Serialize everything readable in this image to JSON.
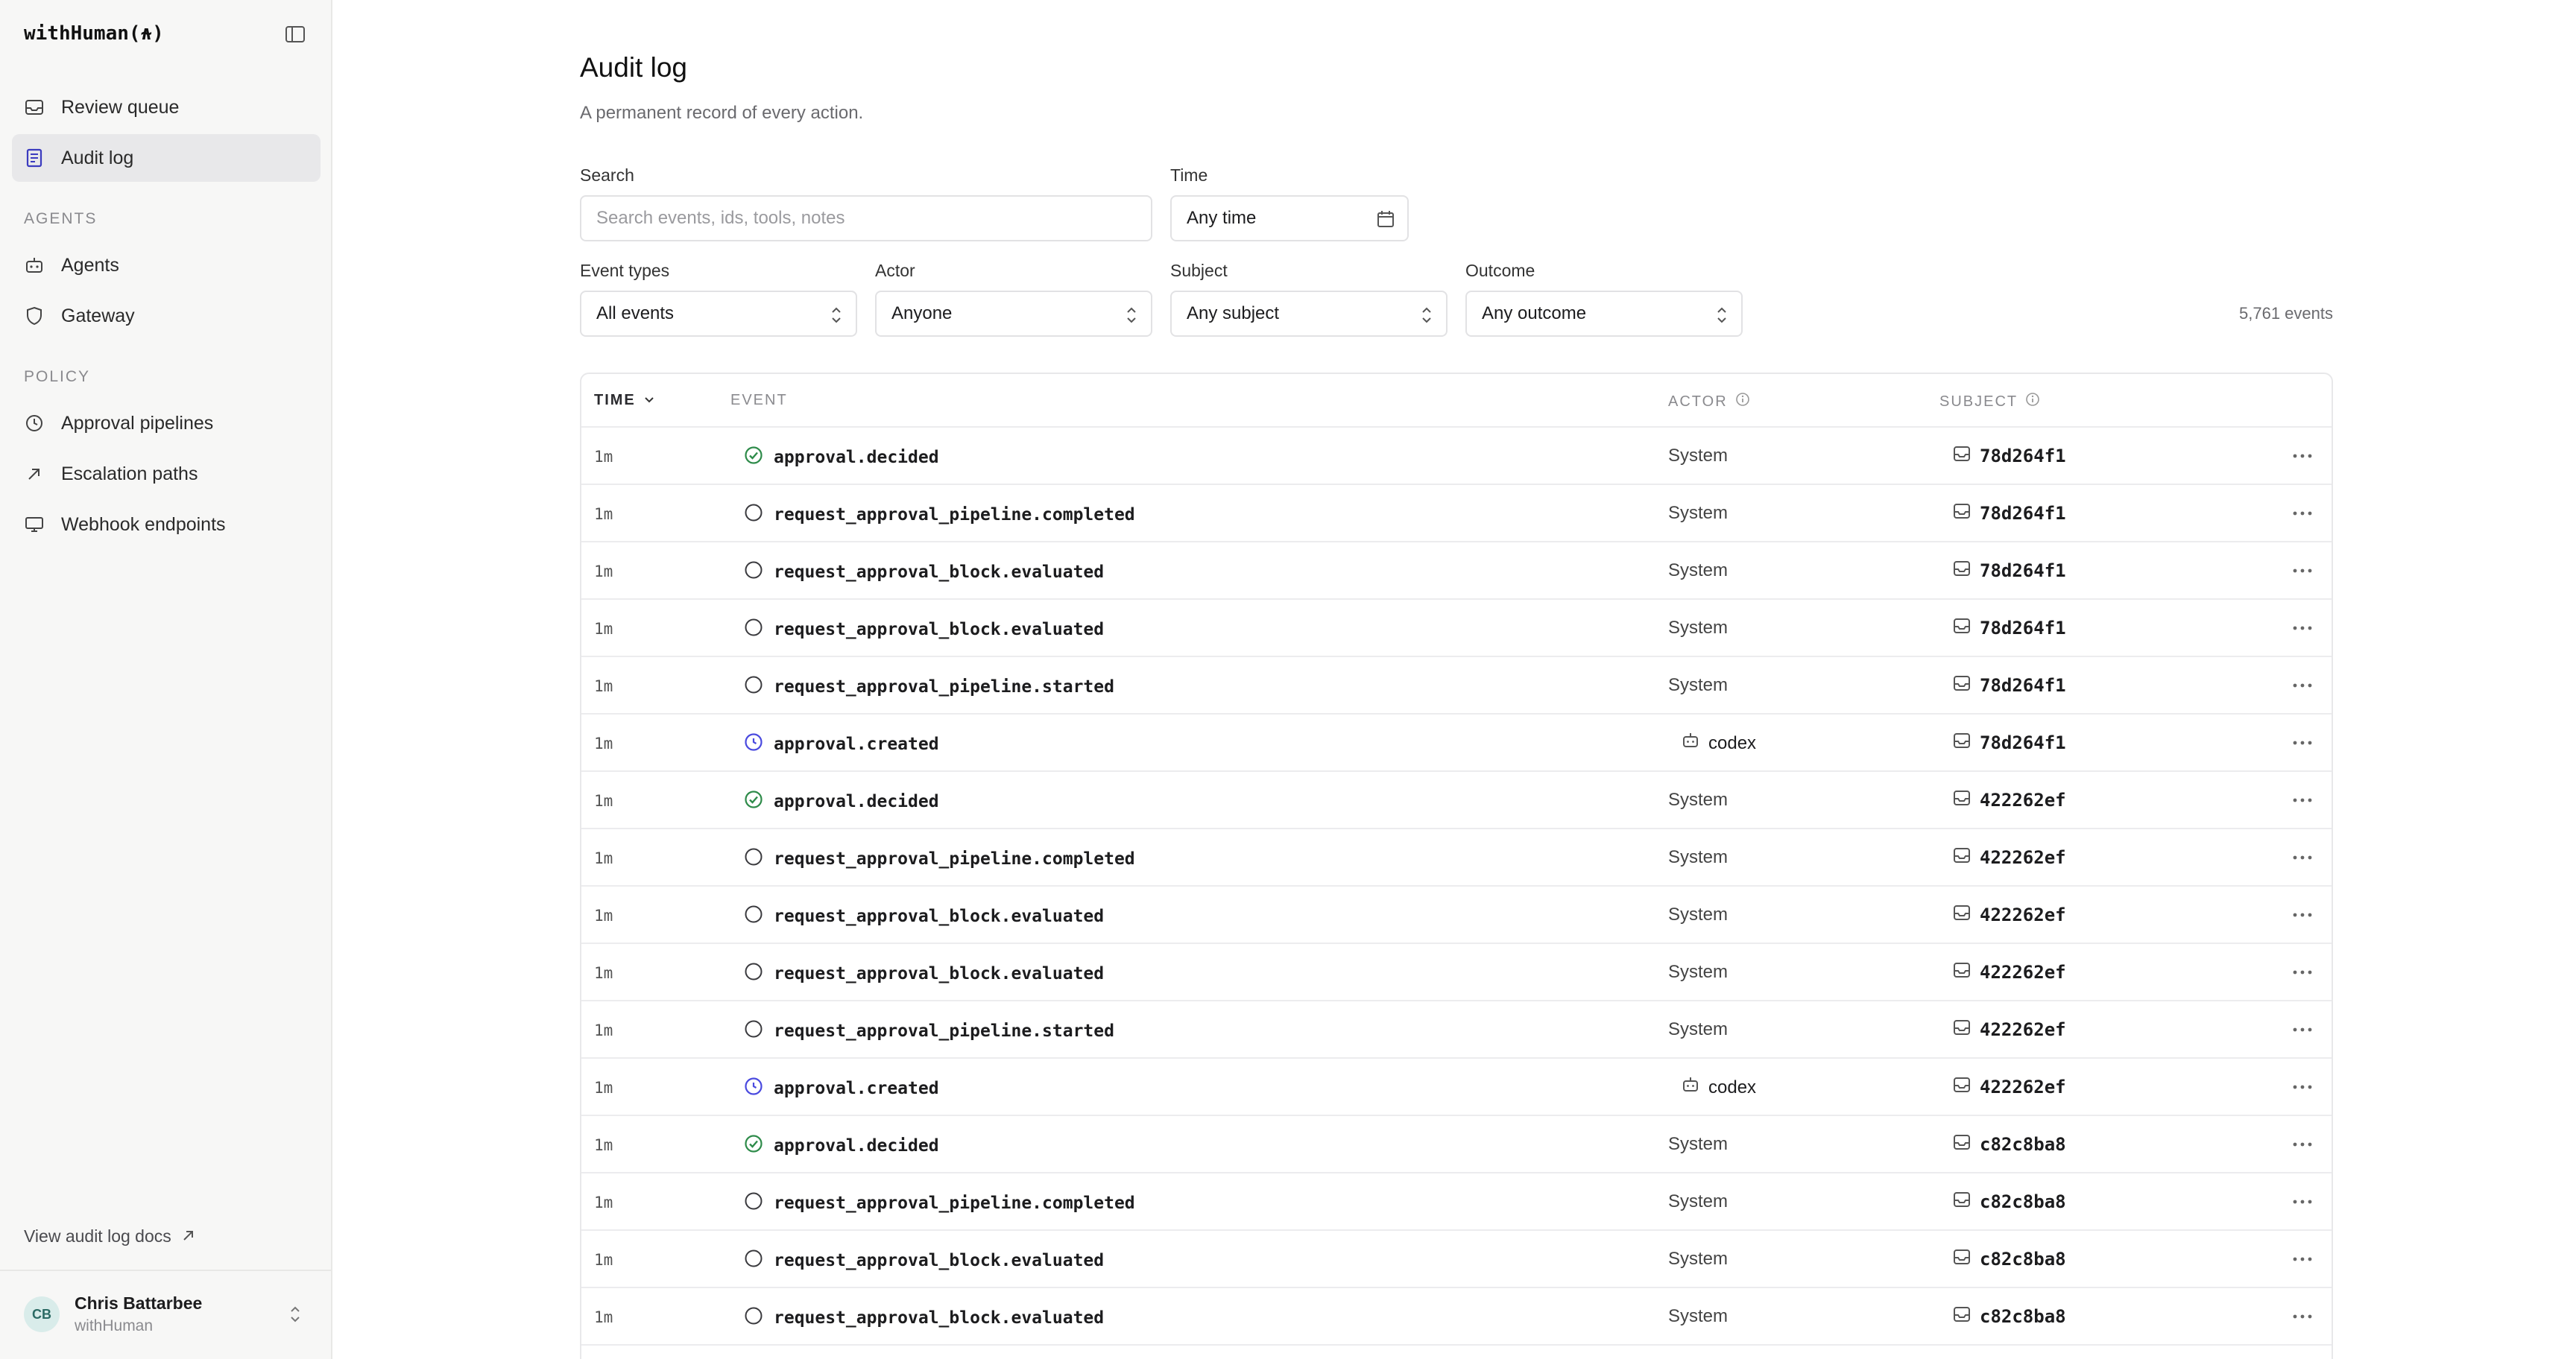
{
  "brand": "withHuman(⍲)",
  "nav": {
    "review_queue": "Review queue",
    "audit_log": "Audit log",
    "agents_section": "AGENTS",
    "agents": "Agents",
    "gateway": "Gateway",
    "policy_section": "POLICY",
    "approval_pipelines": "Approval pipelines",
    "escalation_paths": "Escalation paths",
    "webhook_endpoints": "Webhook endpoints"
  },
  "docs_link": "View audit log docs",
  "user": {
    "initials": "CB",
    "name": "Chris Battarbee",
    "org": "withHuman"
  },
  "page": {
    "title": "Audit log",
    "subtitle": "A permanent record of every action."
  },
  "filters": {
    "search_label": "Search",
    "search_placeholder": "Search events, ids, tools, notes",
    "time_label": "Time",
    "time_value": "Any time",
    "event_types_label": "Event types",
    "event_types_value": "All events",
    "actor_label": "Actor",
    "actor_value": "Anyone",
    "subject_label": "Subject",
    "subject_value": "Any subject",
    "outcome_label": "Outcome",
    "outcome_value": "Any outcome"
  },
  "event_count": "5,761 events",
  "table": {
    "headers": {
      "time": "TIME",
      "event": "EVENT",
      "actor": "ACTOR",
      "subject": "SUBJECT"
    },
    "rows": [
      {
        "time": "1m",
        "event": "approval.decided",
        "status": "success",
        "actor": "System",
        "actor_type": "system",
        "subject": "78d264f1"
      },
      {
        "time": "1m",
        "event": "request_approval_pipeline.completed",
        "status": "neutral",
        "actor": "System",
        "actor_type": "system",
        "subject": "78d264f1"
      },
      {
        "time": "1m",
        "event": "request_approval_block.evaluated",
        "status": "neutral",
        "actor": "System",
        "actor_type": "system",
        "subject": "78d264f1"
      },
      {
        "time": "1m",
        "event": "request_approval_block.evaluated",
        "status": "neutral",
        "actor": "System",
        "actor_type": "system",
        "subject": "78d264f1"
      },
      {
        "time": "1m",
        "event": "request_approval_pipeline.started",
        "status": "neutral",
        "actor": "System",
        "actor_type": "system",
        "subject": "78d264f1"
      },
      {
        "time": "1m",
        "event": "approval.created",
        "status": "pending",
        "actor": "codex",
        "actor_type": "agent",
        "subject": "78d264f1"
      },
      {
        "time": "1m",
        "event": "approval.decided",
        "status": "success",
        "actor": "System",
        "actor_type": "system",
        "subject": "422262ef"
      },
      {
        "time": "1m",
        "event": "request_approval_pipeline.completed",
        "status": "neutral",
        "actor": "System",
        "actor_type": "system",
        "subject": "422262ef"
      },
      {
        "time": "1m",
        "event": "request_approval_block.evaluated",
        "status": "neutral",
        "actor": "System",
        "actor_type": "system",
        "subject": "422262ef"
      },
      {
        "time": "1m",
        "event": "request_approval_block.evaluated",
        "status": "neutral",
        "actor": "System",
        "actor_type": "system",
        "subject": "422262ef"
      },
      {
        "time": "1m",
        "event": "request_approval_pipeline.started",
        "status": "neutral",
        "actor": "System",
        "actor_type": "system",
        "subject": "422262ef"
      },
      {
        "time": "1m",
        "event": "approval.created",
        "status": "pending",
        "actor": "codex",
        "actor_type": "agent",
        "subject": "422262ef"
      },
      {
        "time": "1m",
        "event": "approval.decided",
        "status": "success",
        "actor": "System",
        "actor_type": "system",
        "subject": "c82c8ba8"
      },
      {
        "time": "1m",
        "event": "request_approval_pipeline.completed",
        "status": "neutral",
        "actor": "System",
        "actor_type": "system",
        "subject": "c82c8ba8"
      },
      {
        "time": "1m",
        "event": "request_approval_block.evaluated",
        "status": "neutral",
        "actor": "System",
        "actor_type": "system",
        "subject": "c82c8ba8"
      },
      {
        "time": "1m",
        "event": "request_approval_block.evaluated",
        "status": "neutral",
        "actor": "System",
        "actor_type": "system",
        "subject": "c82c8ba8"
      }
    ]
  },
  "colors": {
    "success": "#2e8b4a",
    "pending": "#4a4adf",
    "neutral": "#3a3a3e",
    "active_nav": "#e8e8ea"
  },
  "icons": {
    "success": "check-circle-icon",
    "neutral": "circle-icon",
    "pending": "clock-circle-icon",
    "agent": "robot-icon",
    "subject": "inbox-icon",
    "more": "ellipsis-icon"
  }
}
